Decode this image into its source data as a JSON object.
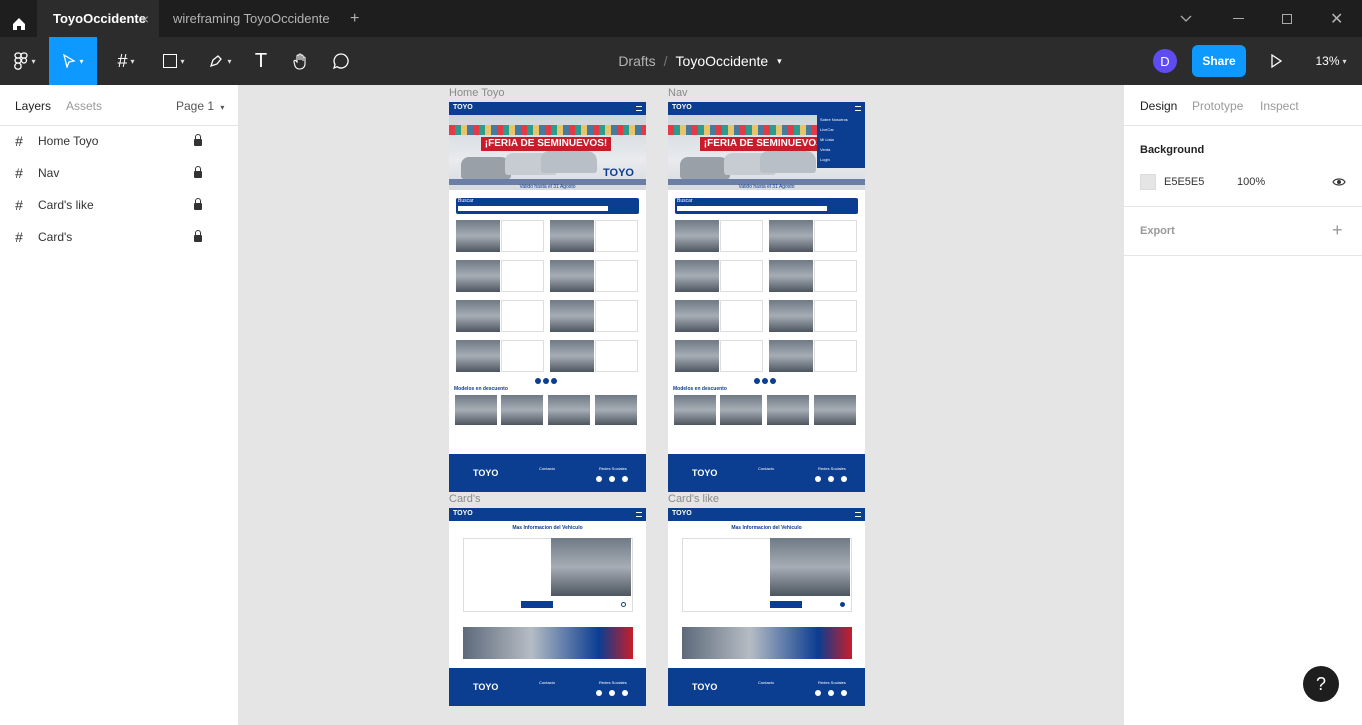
{
  "tabs": [
    {
      "label": "ToyoOccidente",
      "active": true
    },
    {
      "label": "wireframing ToyoOccidente",
      "active": false
    }
  ],
  "toolbar": {
    "breadcrumb_parent": "Drafts",
    "breadcrumb_sep": "/",
    "file_name": "ToyoOccidente",
    "avatar_initial": "D",
    "share_label": "Share",
    "zoom": "13%"
  },
  "left_panel": {
    "tabs": [
      "Layers",
      "Assets"
    ],
    "page_selector": "Page 1",
    "layers": [
      {
        "name": "Home Toyo",
        "locked": true
      },
      {
        "name": "Nav",
        "locked": true
      },
      {
        "name": "Card's like",
        "locked": true
      },
      {
        "name": "Card's",
        "locked": true
      }
    ]
  },
  "canvas": {
    "frames": [
      {
        "label": "Home Toyo"
      },
      {
        "label": "Nav"
      },
      {
        "label": "Card's"
      },
      {
        "label": "Card's like"
      }
    ],
    "banner_title": "¡FERIA DE SEMINUEVOS!",
    "banner_sub": "Valido hasta el 31 Agosto",
    "search_label": "Buscar",
    "section_title": "Modelos en descuento",
    "detail_title": "Mas Informacion del Vehiculo",
    "footer_logo": "TOYO",
    "footer_contact": "Contacto",
    "footer_social": "Redes Sociales",
    "brand": "TOYO",
    "nav_items": [
      "Sobre Nosotros",
      "LiveCar",
      "Mi Lista",
      "Venta",
      "Login"
    ]
  },
  "right_panel": {
    "tabs": [
      "Design",
      "Prototype",
      "Inspect"
    ],
    "background_label": "Background",
    "bg_hex": "E5E5E5",
    "bg_opacity": "100%",
    "export_label": "Export"
  },
  "help_label": "?",
  "colors": {
    "accent": "#0d99ff",
    "dark": "#2c2c2c",
    "canvas": "#e5e5e5",
    "brand_blue": "#0b3d91"
  }
}
